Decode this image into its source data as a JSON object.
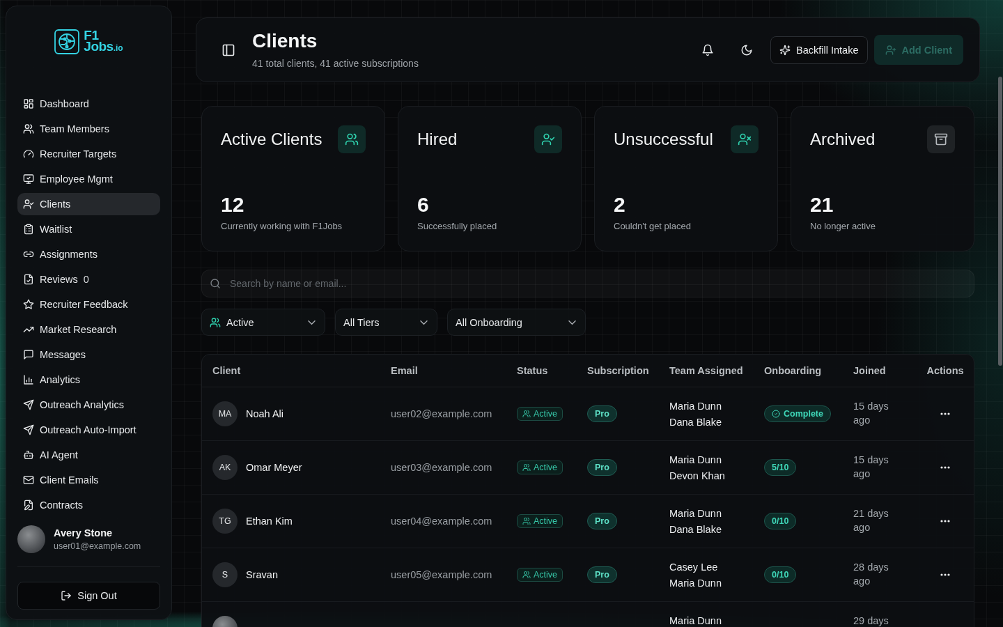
{
  "sidebar": {
    "logo": {
      "top": "F1",
      "bottom": "Jobs",
      "suffix": ".io"
    },
    "items": [
      {
        "label": "Dashboard",
        "selected": false
      },
      {
        "label": "Team Members",
        "selected": false
      },
      {
        "label": "Recruiter Targets",
        "selected": false
      },
      {
        "label": "Employee Mgmt",
        "selected": false
      },
      {
        "label": "Clients",
        "selected": true
      },
      {
        "label": "Waitlist",
        "selected": false
      },
      {
        "label": "Assignments",
        "selected": false
      },
      {
        "label": "Reviews",
        "count": "0",
        "selected": false
      },
      {
        "label": "Recruiter Feedback",
        "selected": false
      },
      {
        "label": "Market Research",
        "selected": false
      },
      {
        "label": "Messages",
        "selected": false
      },
      {
        "label": "Analytics",
        "selected": false
      },
      {
        "label": "Outreach Analytics",
        "selected": false
      },
      {
        "label": "Outreach Auto-Import",
        "selected": false
      },
      {
        "label": "AI Agent",
        "selected": false
      },
      {
        "label": "Client Emails",
        "selected": false
      },
      {
        "label": "Contracts",
        "selected": false
      }
    ],
    "user": {
      "name": "Avery Stone",
      "email": "user01@example.com"
    },
    "sign_out": "Sign Out"
  },
  "header": {
    "title": "Clients",
    "subtitle": "41 total clients, 41 active subscriptions",
    "buttons": [
      {
        "label": "Backfill Intake",
        "kind": "outline",
        "disabled": false
      },
      {
        "label": "Add Client",
        "kind": "primary",
        "disabled": true
      }
    ]
  },
  "stats": [
    {
      "kind": "active",
      "title": "Active Clients",
      "value": "12",
      "caption": "Currently working with F1Jobs"
    },
    {
      "kind": "hired",
      "title": "Hired",
      "value": "6",
      "caption": "Successfully placed"
    },
    {
      "kind": "unsuccessful",
      "title": "Unsuccessful",
      "value": "2",
      "caption": "Couldn't get placed"
    },
    {
      "kind": "archived",
      "title": "Archived",
      "value": "21",
      "caption": "No longer active"
    }
  ],
  "search": {
    "placeholder": "Search by name or email..."
  },
  "filters": [
    {
      "kind": "status",
      "value": "Active"
    },
    {
      "kind": "tier",
      "value": "All Tiers"
    },
    {
      "kind": "onboarding",
      "value": "All Onboarding"
    }
  ],
  "table": {
    "columns": [
      "Client",
      "Email",
      "Status",
      "Subscription",
      "Team Assigned",
      "Onboarding",
      "Joined",
      "Actions"
    ],
    "rows": [
      {
        "initials": "MA",
        "name": "Noah Ali",
        "email": "user02@example.com",
        "status": "Active",
        "subscription": "Pro",
        "team": [
          "Maria Dunn",
          "Dana Blake"
        ],
        "onboarding": {
          "label": "Complete",
          "complete": true
        },
        "joined": "15 days ago"
      },
      {
        "initials": "AK",
        "name": "Omar Meyer",
        "email": "user03@example.com",
        "status": "Active",
        "subscription": "Pro",
        "team": [
          "Maria Dunn",
          "Devon Khan"
        ],
        "onboarding": {
          "label": "5/10",
          "complete": false
        },
        "joined": "15 days ago"
      },
      {
        "initials": "TG",
        "name": "Ethan Kim",
        "email": "user04@example.com",
        "status": "Active",
        "subscription": "Pro",
        "team": [
          "Maria Dunn",
          "Dana Blake"
        ],
        "onboarding": {
          "label": "0/10",
          "complete": false
        },
        "joined": "21 days ago"
      },
      {
        "initials": "S",
        "name": "Sravan",
        "email": "user05@example.com",
        "status": "Active",
        "subscription": "Pro",
        "team": [
          "Casey Lee",
          "Maria Dunn"
        ],
        "onboarding": {
          "label": "0/10",
          "complete": false
        },
        "joined": "28 days ago"
      },
      {
        "team": [
          "Maria Dunn"
        ],
        "joined": "29 days"
      }
    ]
  }
}
